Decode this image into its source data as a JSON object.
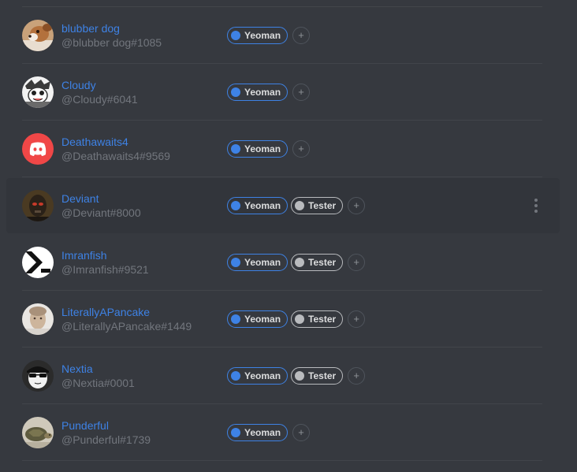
{
  "roles": {
    "yeoman": {
      "label": "Yeoman",
      "color": "#3e82e5"
    },
    "tester": {
      "label": "Tester",
      "color": "#b9bbbe"
    },
    "add_label": "+"
  },
  "members": [
    {
      "name": "blubber dog",
      "tag": "@blubber dog#1085",
      "avatar": "dog-avatar",
      "roles": [
        "Yeoman"
      ]
    },
    {
      "name": "Cloudy",
      "tag": "@Cloudy#6041",
      "avatar": "cartoon-avatar",
      "roles": [
        "Yeoman"
      ]
    },
    {
      "name": "Deathawaits4",
      "tag": "@Deathawaits4#9569",
      "avatar": "discord-logo-avatar",
      "roles": [
        "Yeoman"
      ]
    },
    {
      "name": "Deviant",
      "tag": "@Deviant#8000",
      "avatar": "face-avatar",
      "roles": [
        "Yeoman",
        "Tester"
      ]
    },
    {
      "name": "Imranfish",
      "tag": "@Imranfish#9521",
      "avatar": "chevron-avatar",
      "roles": [
        "Yeoman",
        "Tester"
      ]
    },
    {
      "name": "LiterallyAPancake",
      "tag": "@LiterallyAPancake#1449",
      "avatar": "photo-avatar",
      "roles": [
        "Yeoman",
        "Tester"
      ]
    },
    {
      "name": "Nextia",
      "tag": "@Nextia#0001",
      "avatar": "sunglasses-avatar",
      "roles": [
        "Yeoman",
        "Tester"
      ]
    },
    {
      "name": "Punderful",
      "tag": "@Punderful#1739",
      "avatar": "turtle-avatar",
      "roles": [
        "Yeoman"
      ]
    }
  ],
  "colors": {
    "background": "#36393f",
    "username": "#3e82e5",
    "tag": "#72767d",
    "discord_blurple": "#f04747"
  }
}
